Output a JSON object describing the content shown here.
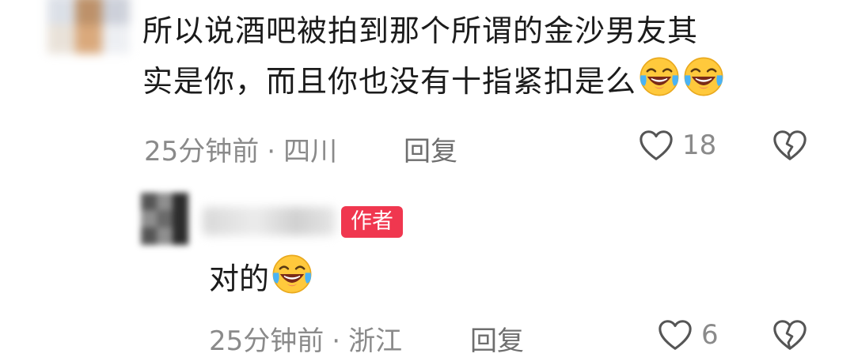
{
  "comment": {
    "line1": "所以说酒吧被拍到那个所谓的金沙男友其",
    "line2": "实是你，而且你也没有十指紧扣是么",
    "emoji_names": [
      "face-with-tears-of-joy-icon",
      "face-with-tears-of-joy-icon"
    ],
    "time": "25分钟前",
    "separator": "·",
    "location": "四川",
    "reply_label": "回复",
    "like_count": "18"
  },
  "reply": {
    "author_badge": "作者",
    "text": "对的",
    "emoji_name": "face-with-tears-of-joy-icon",
    "time": "25分钟前",
    "separator": "·",
    "location": "浙江",
    "reply_label": "回复",
    "like_count": "6"
  },
  "colors": {
    "badge": "#f0374f",
    "meta_text": "#8a8a8a",
    "body_text": "#1b1b1b",
    "icon_stroke": "#555555"
  }
}
